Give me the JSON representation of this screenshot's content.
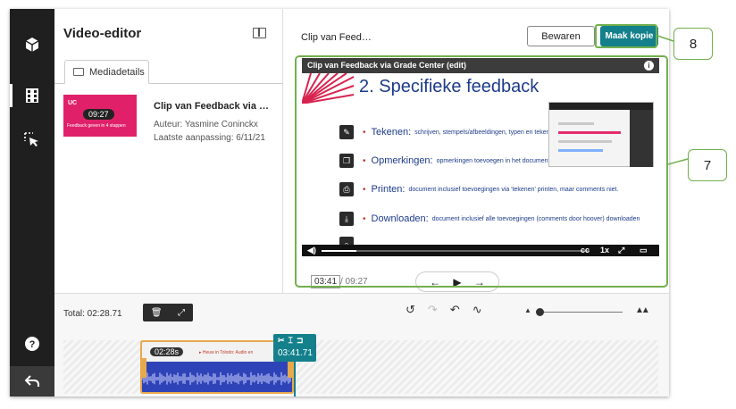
{
  "app": {
    "title": "Video-editor"
  },
  "left_panel": {
    "tab_label": "Mediadetails",
    "media": {
      "name": "Clip van Feedback via …",
      "author": "Auteur: Yasmine Coninckx",
      "modified": "Laatste aanpassing: 6/11/21",
      "thumb_duration": "09:27",
      "thumb_logo": "UC",
      "thumb_caption": "Feedback geven in 4 stappen"
    }
  },
  "header": {
    "clip_title": "Clip van Feed…",
    "save_label": "Bewaren",
    "copy_label": "Maak kopie"
  },
  "player": {
    "title_bar": "Clip van Feedback via Grade Center (edit)",
    "info_glyph": "i",
    "slide_heading": "2. Specifieke feedback",
    "bullets": [
      {
        "term": "Tekenen:",
        "desc": "schrijven, stempels/afbeeldingen, typen en tekenen"
      },
      {
        "term": "Opmerkingen:",
        "desc": "opmerkingen toevoegen in het document"
      },
      {
        "term": "Printen:",
        "desc": "document inclusief toevoegingen via 'tekenen' printen, maar comments niet."
      },
      {
        "term": "Downloaden:",
        "desc": "document inclusief alle toevoegingen (comments door hoover) downloaden"
      }
    ],
    "speed": "1x",
    "cc": "cc",
    "progress_fraction": 0.13
  },
  "transport": {
    "current_time": "03:41",
    "total_time": "/ 09:27"
  },
  "timeline": {
    "total_label": "Total: 02:28.71",
    "clip_duration": "02:28s",
    "clip_text": "▸ Heuw in Tolodo: Audio en",
    "playhead_time": "03:41.71"
  },
  "callouts": {
    "seven": "7",
    "eight": "8"
  },
  "colors": {
    "accent": "#13808c",
    "callout": "#72b04d",
    "rail": "#1f1f1f",
    "clip_border": "#e8a84c"
  }
}
